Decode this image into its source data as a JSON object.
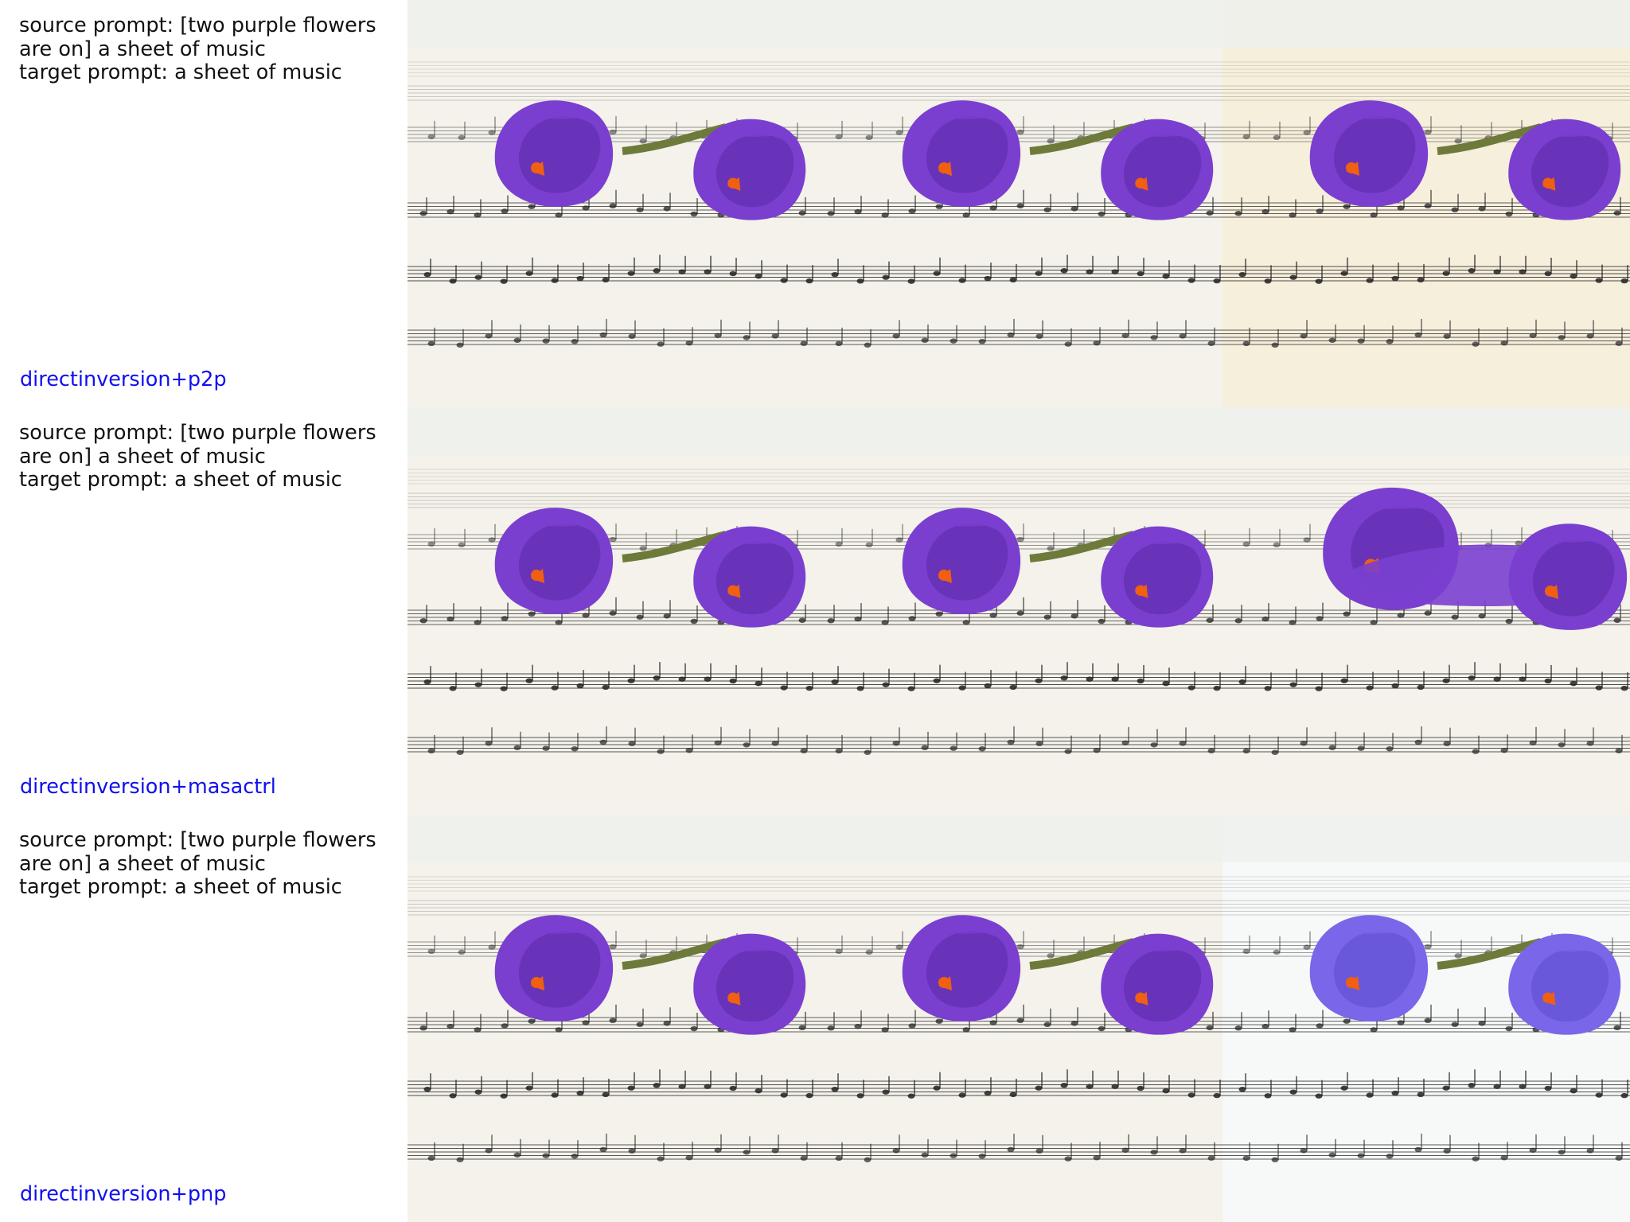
{
  "rows": [
    {
      "source_prompt_line1": "source prompt: [two purple flowers",
      "source_prompt_line2": "are on] a sheet of music",
      "target_prompt": "target prompt: a sheet of music",
      "method": "directinversion+p2p"
    },
    {
      "source_prompt_line1": "source prompt: [two purple flowers",
      "source_prompt_line2": "are on] a sheet of music",
      "target_prompt": "target prompt: a sheet of music",
      "method": "directinversion+masactrl"
    },
    {
      "source_prompt_line1": "source prompt: [two purple flowers",
      "source_prompt_line2": "are on] a sheet of music",
      "target_prompt": "target prompt: a sheet of music",
      "method": "directinversion+pnp"
    }
  ],
  "colors": {
    "method_label": "#1010ee",
    "petal": "#7a3fcf",
    "petal_dark": "#5a2aa8",
    "stamen": "#f06010",
    "paper": "#f4f2ea",
    "ink": "#222222"
  },
  "icons": [
    "purple-crocus-flower",
    "sheet-music-staff"
  ]
}
